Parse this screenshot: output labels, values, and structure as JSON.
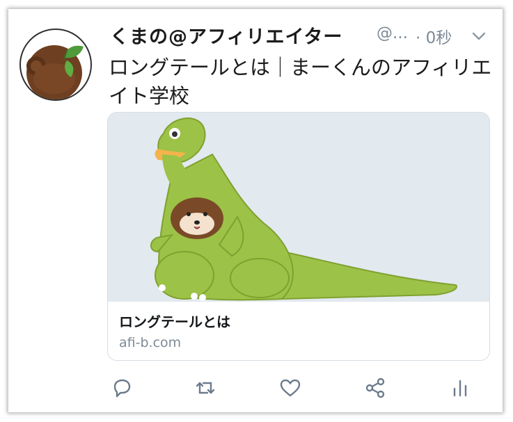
{
  "tweet": {
    "display_name": "くまの@アフィリエイター",
    "handle": "@...",
    "timestamp": "· 0秒",
    "text": "ロングテールとは｜まーくんのアフィリエイト学校"
  },
  "card": {
    "title": "ロングテールとは",
    "domain": "afi-b.com"
  },
  "icons": {
    "menu": "chevron-down-icon",
    "reply": "reply-icon",
    "retweet": "retweet-icon",
    "like": "heart-icon",
    "share": "share-icon",
    "analytics": "analytics-icon"
  },
  "colors": {
    "text": "#1b1b1b",
    "muted": "#7d8a97",
    "dinosaur": "#9cc247",
    "image_background": "#e2e9ef",
    "icon": "#6b7b8c"
  }
}
